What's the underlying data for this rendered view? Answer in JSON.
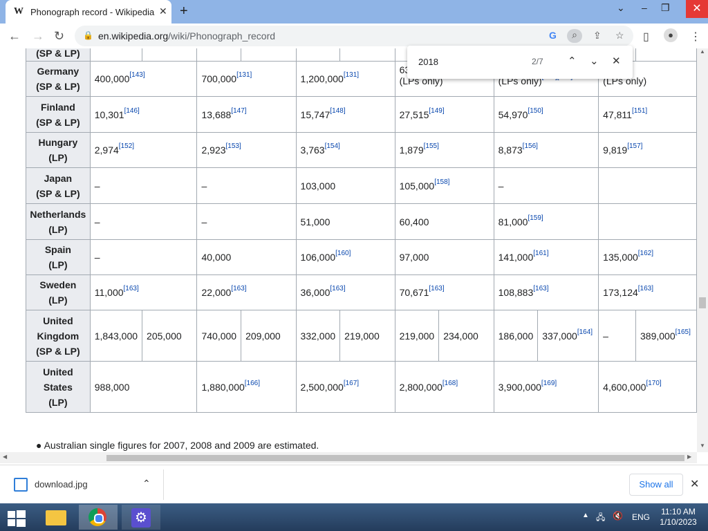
{
  "browser": {
    "tab_title": "Phonograph record - Wikipedia",
    "url_domain": "en.wikipedia.org",
    "url_path": "/wiki/Phonograph_record"
  },
  "find": {
    "query": "2018",
    "count": "2/7"
  },
  "table": {
    "partial_top_label": "(SP & LP)",
    "rows": [
      {
        "country": [
          "Germany",
          "(SP & LP)"
        ],
        "cells": [
          {
            "t": "400,000",
            "r": "[143]"
          },
          {
            "t": "700,000",
            "r": "[131]"
          },
          {
            "t": "1,200,000",
            "r": "[131]"
          },
          {
            "t": "63",
            "sub": "(LPs only)"
          },
          {
            "t": "",
            "sub": "(LPs only)",
            "r": "[144][145]"
          },
          {
            "t": "00",
            "sub": "(LPs only)"
          }
        ]
      },
      {
        "country": [
          "Finland",
          "(SP & LP)"
        ],
        "cells": [
          {
            "t": "10,301",
            "r": "[146]"
          },
          {
            "t": "13,688",
            "r": "[147]"
          },
          {
            "t": "15,747",
            "r": "[148]"
          },
          {
            "t": "27,515",
            "r": "[149]"
          },
          {
            "t": "54,970",
            "r": "[150]"
          },
          {
            "t": "47,811",
            "r": "[151]"
          }
        ]
      },
      {
        "country": [
          "Hungary",
          "(LP)"
        ],
        "cells": [
          {
            "t": "2,974",
            "r": "[152]"
          },
          {
            "t": "2,923",
            "r": "[153]"
          },
          {
            "t": "3,763",
            "r": "[154]"
          },
          {
            "t": "1,879",
            "r": "[155]"
          },
          {
            "t": "8,873",
            "r": "[156]"
          },
          {
            "t": "9,819",
            "r": "[157]"
          }
        ]
      },
      {
        "country": [
          "Japan",
          "(SP & LP)"
        ],
        "cells": [
          {
            "t": "–"
          },
          {
            "t": "–"
          },
          {
            "t": "103,000"
          },
          {
            "t": "105,000",
            "r": "[158]"
          },
          {
            "t": "–"
          },
          {
            "t": ""
          }
        ]
      },
      {
        "country": [
          "Netherlands",
          "(LP)"
        ],
        "cells": [
          {
            "t": "–"
          },
          {
            "t": "–"
          },
          {
            "t": "51,000"
          },
          {
            "t": "60,400"
          },
          {
            "t": "81,000",
            "r": "[159]"
          },
          {
            "t": ""
          }
        ]
      },
      {
        "country": [
          "Spain",
          "(LP)"
        ],
        "cells": [
          {
            "t": "–"
          },
          {
            "t": "40,000"
          },
          {
            "t": "106,000",
            "r": "[160]"
          },
          {
            "t": "97,000"
          },
          {
            "t": "141,000",
            "r": "[161]"
          },
          {
            "t": "135,000",
            "r": "[162]"
          }
        ]
      },
      {
        "country": [
          "Sweden",
          "(LP)"
        ],
        "cells": [
          {
            "t": "11,000",
            "r": "[163]"
          },
          {
            "t": "22,000",
            "r": "[163]"
          },
          {
            "t": "36,000",
            "r": "[163]"
          },
          {
            "t": "70,671",
            "r": "[163]"
          },
          {
            "t": "108,883",
            "r": "[163]"
          },
          {
            "t": "173,124",
            "r": "[163]"
          }
        ]
      }
    ],
    "uk": {
      "country": [
        "United",
        "Kingdom",
        "(SP & LP)"
      ],
      "cells": [
        {
          "t": "1,843,000"
        },
        {
          "t": "205,000"
        },
        {
          "t": "740,000"
        },
        {
          "t": "209,000"
        },
        {
          "t": "332,000"
        },
        {
          "t": "219,000"
        },
        {
          "t": "219,000"
        },
        {
          "t": "234,000"
        },
        {
          "t": "186,000"
        },
        {
          "t": "337,000",
          "r": "[164]"
        },
        {
          "t": "–"
        },
        {
          "t": "389,000",
          "r": "[165]"
        }
      ]
    },
    "us": {
      "country": [
        "United",
        "States",
        "(LP)"
      ],
      "cells": [
        {
          "t": "988,000"
        },
        {
          "t": "1,880,000",
          "r": "[166]"
        },
        {
          "t": "2,500,000",
          "r": "[167]"
        },
        {
          "t": "2,800,000",
          "r": "[168]"
        },
        {
          "t": "3,900,000",
          "r": "[169]"
        },
        {
          "t": "4,600,000",
          "r": "[170]"
        }
      ]
    },
    "note": "Australian single figures for 2007, 2008 and 2009 are estimated."
  },
  "downloads": {
    "file": "download.jpg",
    "show_all": "Show all"
  },
  "taskbar": {
    "time": "11:10 AM",
    "date": "1/10/2023",
    "lang": "ENG"
  }
}
